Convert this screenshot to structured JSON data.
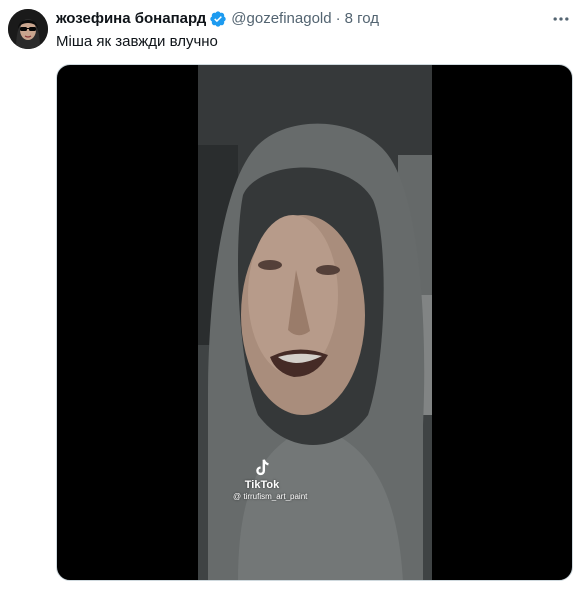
{
  "author": {
    "display_name": "жозефина бонапард",
    "handle": "@gozefinagold",
    "separator": "·",
    "time": "8 год",
    "verified": true,
    "avatar_icon": "avatar-sunglasses"
  },
  "tweet": {
    "text": "Міша як завжди влучно"
  },
  "media": {
    "type": "video",
    "watermark_brand": "TikTok",
    "watermark_user": "@ tirrufism_art_paint"
  },
  "icons": {
    "verified": "verified-badge-icon",
    "more": "more-options-icon",
    "tiktok": "tiktok-logo-icon"
  },
  "colors": {
    "primary_text": "#0f1419",
    "secondary_text": "#536471",
    "verified_blue": "#1d9bf0"
  }
}
